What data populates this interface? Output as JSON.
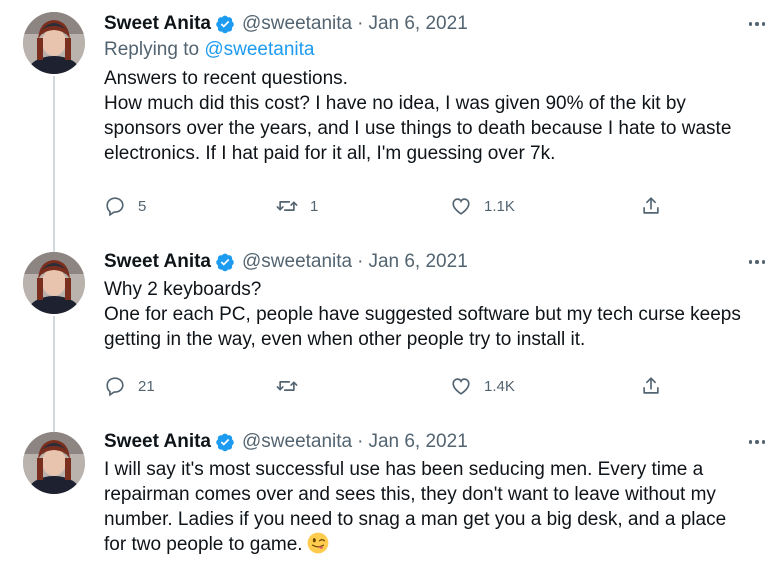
{
  "tweets": [
    {
      "author_name": "Sweet Anita",
      "author_handle": "@sweetanita",
      "separator": "·",
      "date": "Jan 6, 2021",
      "replying_prefix": "Replying to ",
      "replying_handle": "@sweetanita",
      "lines": [
        "Answers to recent questions.",
        "How much did this cost? I have no idea, I was given 90% of the kit by",
        "sponsors over the years, and I use things to death because I hate to waste",
        "electronics. If I hat paid for it all, I'm guessing over 7k."
      ],
      "replies": "5",
      "retweets": "1",
      "likes": "1.1K"
    },
    {
      "author_name": "Sweet Anita",
      "author_handle": "@sweetanita",
      "separator": "·",
      "date": "Jan 6, 2021",
      "lines": [
        "Why 2 keyboards?",
        "One for each PC, people have suggested software but my tech curse keeps",
        "getting in the way, even when other people try to install it."
      ],
      "replies": "21",
      "retweets": "",
      "likes": "1.4K"
    },
    {
      "author_name": "Sweet Anita",
      "author_handle": "@sweetanita",
      "separator": "·",
      "date": "Jan 6, 2021",
      "lines": [
        "I will say it's most successful use has been seducing men. Every time a",
        "repairman comes over and sees this, they don't want to leave without my",
        "number. Ladies if you need to snag a man get you a big desk, and a place",
        "for two people to game."
      ],
      "emoji": "winking-face-with-tongue"
    }
  ],
  "icons": {
    "reply": "reply-icon",
    "retweet": "retweet-icon",
    "like": "heart-icon",
    "share": "share-icon",
    "verified": "verified-badge-icon",
    "more": "more-icon"
  },
  "colors": {
    "text": "#0f1419",
    "secondary": "#536471",
    "accent": "#1d9bf0",
    "thread_line": "#cfd9de"
  }
}
